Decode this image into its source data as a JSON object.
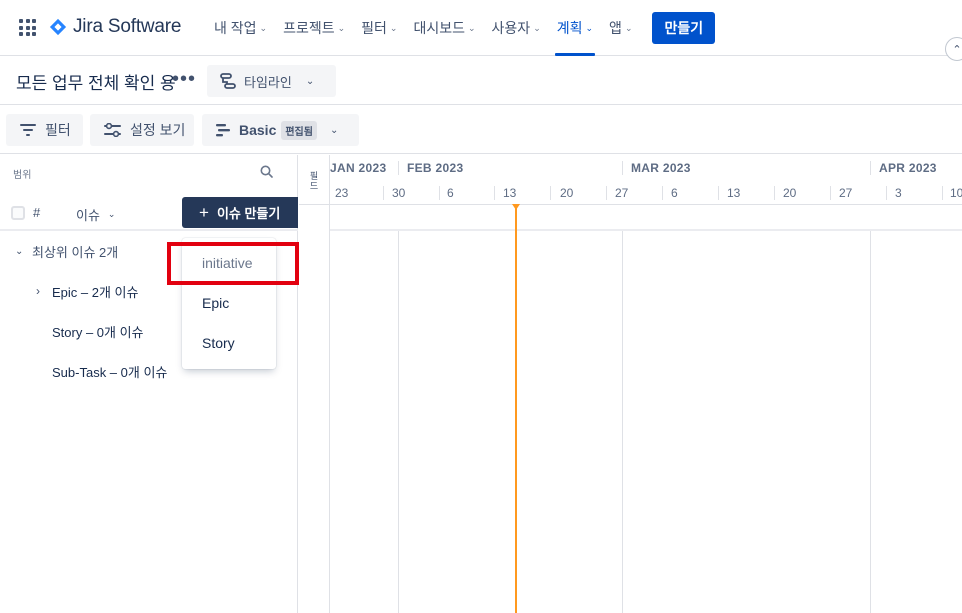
{
  "nav": {
    "brand": "Jira Software",
    "items": [
      {
        "label": "내 작업"
      },
      {
        "label": "프로젝트"
      },
      {
        "label": "필터"
      },
      {
        "label": "대시보드"
      },
      {
        "label": "사용자"
      },
      {
        "label": "계획"
      },
      {
        "label": "앱"
      }
    ],
    "active_index": 5,
    "create_label": "만들기"
  },
  "page": {
    "title": "모든 업무 전체 확인 용",
    "more_label": "•••",
    "view_label": "타임라인"
  },
  "toolbar": {
    "filter_label": "필터",
    "settings_label": "설정 보기",
    "preset_label": "Basic",
    "preset_badge": "편집됨"
  },
  "left": {
    "scope_label": "범위",
    "hash_label": "#",
    "issue_col_label": "이슈",
    "create_issue_label": "이슈 만들기",
    "tree": [
      {
        "label": "최상위 이슈 2개",
        "expanded": true
      },
      {
        "label": "Epic – 2개 이슈",
        "expanded": false
      },
      {
        "label": "Story – 0개 이슈"
      },
      {
        "label": "Sub-Task – 0개 이슈"
      }
    ]
  },
  "dropdown": {
    "items": [
      {
        "label": "initiative",
        "muted": true
      },
      {
        "label": "Epic"
      },
      {
        "label": "Story"
      }
    ]
  },
  "timeline": {
    "field_label": "필드",
    "months": [
      "JAN 2023",
      "FEB 2023",
      "MAR 2023",
      "APR 2023"
    ],
    "days": [
      "23",
      "30",
      "6",
      "13",
      "20",
      "27",
      "6",
      "13",
      "20",
      "27",
      "3",
      "10"
    ]
  },
  "colors": {
    "primary": "#0052CC",
    "create_issue_bg": "#253858",
    "today_line": "#FF991F",
    "highlight": "#E2000F"
  }
}
